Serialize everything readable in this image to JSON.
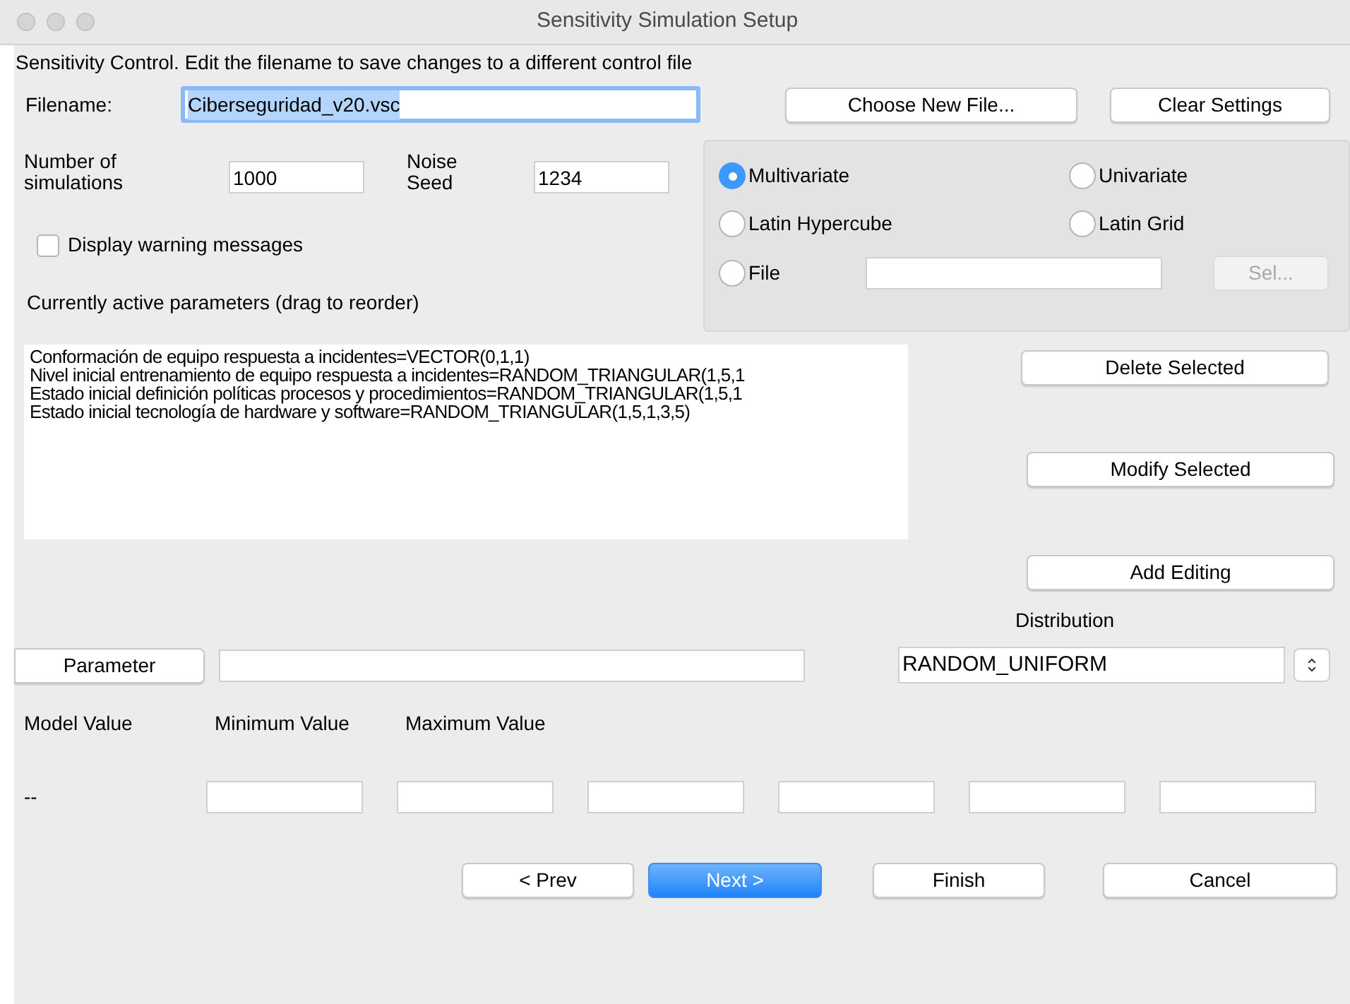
{
  "window": {
    "title": "Sensitivity Simulation Setup"
  },
  "description": "Sensitivity Control.  Edit the filename to save changes to a different control file",
  "filename": {
    "label": "Filename:",
    "value": "Ciberseguridad_v20.vsc"
  },
  "file_buttons": [
    "Choose New File...",
    "Clear Settings"
  ],
  "simulations": {
    "label": "Number of simulations",
    "value": "1000"
  },
  "noise_seed": {
    "label": "Noise Seed",
    "value": "1234"
  },
  "display_warnings": {
    "label": "Display warning messages",
    "checked": false
  },
  "sampling": {
    "options": [
      {
        "label": "Multivariate",
        "selected": true
      },
      {
        "label": "Univariate",
        "selected": false
      },
      {
        "label": "Latin Hypercube",
        "selected": false
      },
      {
        "label": "Latin Grid",
        "selected": false
      },
      {
        "label": "File",
        "selected": false
      }
    ],
    "select_button": {
      "label": "Sel...",
      "disabled": true
    }
  },
  "active_parameters": {
    "label": "Currently active parameters (drag to reorder)",
    "items": [
      "Conformación de equipo respuesta a incidentes=VECTOR(0,1,1)",
      "Nivel inicial entrenamiento de equipo respuesta a incidentes=RANDOM_TRIANGULAR(1,5,1",
      "Estado inicial definición políticas procesos y procedimientos=RANDOM_TRIANGULAR(1,5,1",
      "Estado inicial tecnología de hardware y software=RANDOM_TRIANGULAR(1,5,1,3,5)"
    ]
  },
  "list_buttons": [
    "Delete Selected",
    "Modify Selected",
    "Add Editing"
  ],
  "distribution": {
    "label": "Distribution",
    "value": "RANDOM_UNIFORM"
  },
  "parameter_button": "Parameter",
  "value_columns": [
    "Model Value",
    "Minimum Value",
    "Maximum Value"
  ],
  "model_value": "--",
  "nav_buttons": [
    {
      "label": "< Prev",
      "default": false
    },
    {
      "label": "Next >",
      "default": true
    },
    {
      "label": "Finish",
      "default": false
    },
    {
      "label": "Cancel",
      "default": false
    }
  ]
}
